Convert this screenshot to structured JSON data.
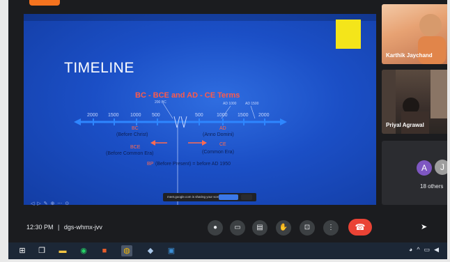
{
  "slide": {
    "title": "TIMELINE",
    "subtitle": "BC - BCE and AD - CE Terms",
    "ticks_left": [
      "2000",
      "1500",
      "1000",
      "500",
      "200 BC"
    ],
    "ticks_right": [
      "500",
      "AD 1000",
      "1000",
      "AD 1500",
      "1500",
      "2000"
    ],
    "bc": "BC",
    "before_christ": "(Before Christ)",
    "bce": "BCE",
    "before_common_era": "(Before Common Era)",
    "ad": "AD",
    "anno_domini": "(Anno Domini)",
    "ce": "CE",
    "common_era": "(Common Era)",
    "bp": "BP",
    "before_present": "(Before Present) = before AD 1950"
  },
  "share_banner": {
    "text": "meet.google.com is sharing your screen."
  },
  "participants": [
    {
      "name": "Karthik Jaychand"
    },
    {
      "name": "Priyal Agrawal"
    }
  ],
  "others": {
    "avatars": [
      "A",
      "J"
    ],
    "count_label": "18 others"
  },
  "meeting": {
    "time": "12:30 PM",
    "separator": "|",
    "code": "dgs-whmx-jvv"
  },
  "colors": {
    "slide_blue": "#1b4fc6",
    "timeline_blue": "#2e86ff",
    "label_red": "#ff5a4a",
    "end_call": "#ea4335",
    "sticky_yellow": "#f4e51a"
  }
}
